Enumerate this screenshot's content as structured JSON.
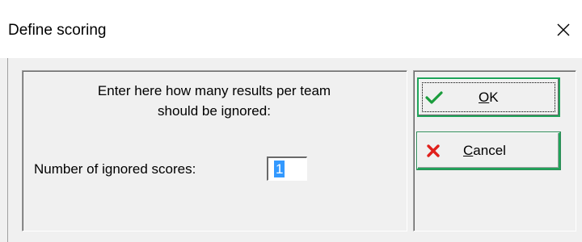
{
  "window": {
    "title": "Define scoring"
  },
  "instruction": {
    "line1": "Enter here how many results per team",
    "line2": "should be ignored:"
  },
  "field": {
    "label": "Number of ignored scores:",
    "value": "1"
  },
  "buttons": {
    "ok": {
      "mnemonic": "O",
      "rest": "K",
      "icon": "checkmark-icon"
    },
    "cancel": {
      "mnemonic": "C",
      "rest": "ancel",
      "icon": "x-mark-icon"
    }
  },
  "colors": {
    "accent_border": "#1fa45a",
    "check_green": "#1a9c3c",
    "x_red": "#e0201b",
    "selection": "#3399ff"
  }
}
